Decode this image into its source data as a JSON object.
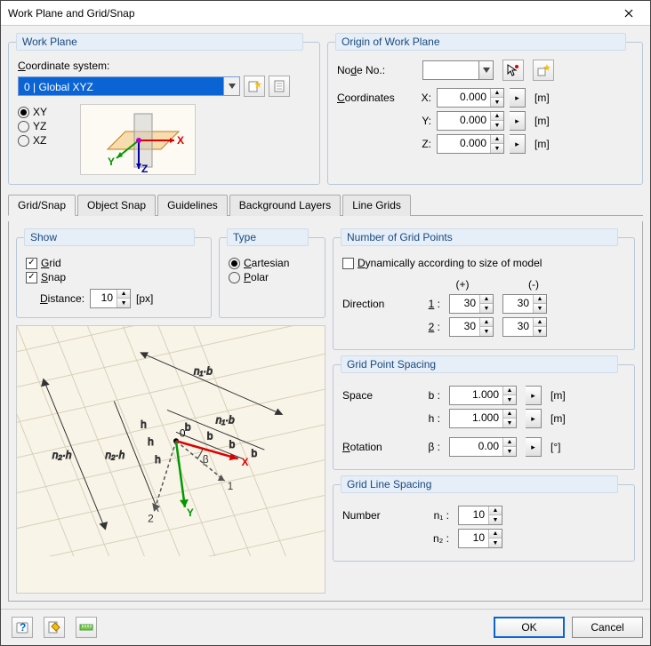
{
  "window": {
    "title": "Work Plane and Grid/Snap"
  },
  "workplane": {
    "legend": "Work Plane",
    "coord_label": "Coordinate system:",
    "coord_value": "0 | Global XYZ",
    "planes": {
      "xy": "XY",
      "yz": "YZ",
      "xz": "XZ"
    },
    "selected_plane": "XY"
  },
  "origin": {
    "legend": "Origin of Work Plane",
    "node_label": "Node No.:",
    "node_value": "",
    "coords_label": "Coordinates",
    "x_label": "X:",
    "x_value": "0.000",
    "x_unit": "[m]",
    "y_label": "Y:",
    "y_value": "0.000",
    "y_unit": "[m]",
    "z_label": "Z:",
    "z_value": "0.000",
    "z_unit": "[m]"
  },
  "tabs": {
    "gridsnap": "Grid/Snap",
    "objectsnap": "Object Snap",
    "guidelines": "Guidelines",
    "background": "Background Layers",
    "linegrids": "Line Grids",
    "active": "gridsnap"
  },
  "show": {
    "legend": "Show",
    "grid": "Grid",
    "grid_checked": true,
    "snap": "Snap",
    "snap_checked": true,
    "distance_label": "Distance:",
    "distance_value": "10",
    "distance_unit": "[px]"
  },
  "type": {
    "legend": "Type",
    "cartesian": "Cartesian",
    "polar": "Polar",
    "selected": "cartesian"
  },
  "gridpoints": {
    "legend": "Number of Grid Points",
    "dyn_label": "Dynamically according to size of model",
    "dyn_checked": false,
    "plus": "(+)",
    "minus": "(-)",
    "direction_label": "Direction",
    "d1_label": "1 :",
    "d1_plus": "30",
    "d1_minus": "30",
    "d2_label": "2 :",
    "d2_plus": "30",
    "d2_minus": "30"
  },
  "spacing": {
    "legend": "Grid Point Spacing",
    "space_label": "Space",
    "b_label": "b :",
    "b_value": "1.000",
    "b_unit": "[m]",
    "h_label": "h :",
    "h_value": "1.000",
    "h_unit": "[m]",
    "rotation_label": "Rotation",
    "beta_label": "β :",
    "beta_value": "0.00",
    "beta_unit": "[°]"
  },
  "linespacing": {
    "legend": "Grid Line Spacing",
    "number_label": "Number",
    "n1_label": "n₁ :",
    "n1_value": "10",
    "n2_label": "n₂ :",
    "n2_value": "10"
  },
  "footer": {
    "ok": "OK",
    "cancel": "Cancel"
  }
}
